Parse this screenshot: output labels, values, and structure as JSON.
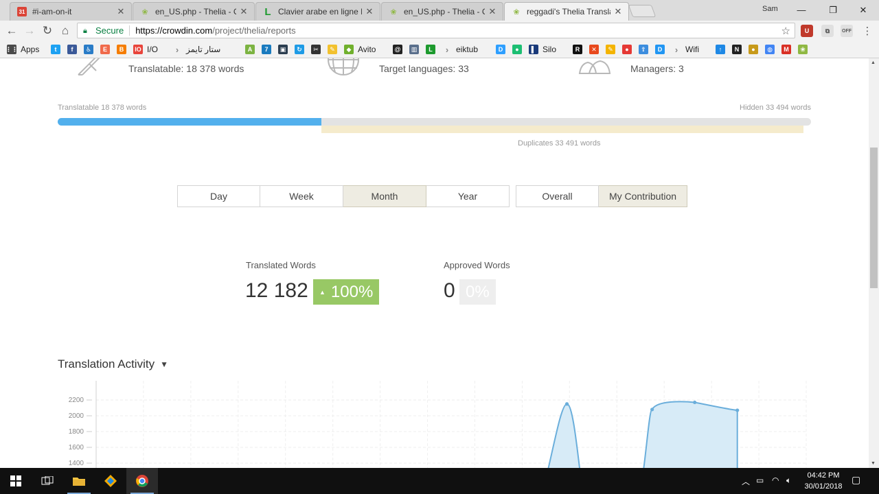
{
  "browser": {
    "tabs": [
      {
        "title": "#i-am-on-it",
        "icon": "google-calendar-icon",
        "color": "#db4437"
      },
      {
        "title": "en_US.php - Thelia - Cro",
        "icon": "crowdin-icon",
        "color": "#8fb843"
      },
      {
        "title": "Clavier arabe en ligne LE",
        "icon": "lexilogos-icon",
        "color": "#1d9a2e"
      },
      {
        "title": "en_US.php - Thelia - Cro",
        "icon": "crowdin-icon",
        "color": "#8fb843"
      },
      {
        "title": "reggadi's Thelia Translati",
        "icon": "crowdin-icon",
        "color": "#8fb843"
      }
    ],
    "profile": "Sam",
    "address": {
      "secure_label": "Secure",
      "url_host": "https://crowdin.com",
      "url_path": "/project/thelia/reports"
    },
    "bookmarks": [
      {
        "label": "Apps",
        "icon": "apps-grid-icon",
        "color": "#4a4a4a"
      },
      {
        "label": "",
        "icon": "twitter-icon",
        "color": "#1da1f2"
      },
      {
        "label": "",
        "icon": "facebook-icon",
        "color": "#3b5998"
      },
      {
        "label": "",
        "icon": "accessibility-icon",
        "color": "#2a7cc7"
      },
      {
        "label": "",
        "icon": "bookmark-icon-e",
        "color": "#f06a4b"
      },
      {
        "label": "",
        "icon": "blogger-icon",
        "color": "#f57d00"
      },
      {
        "label": "I/O",
        "icon": "io-icon",
        "color": "#e8453c"
      },
      {
        "label": "ستار تايمز",
        "icon": "folder-chevron-icon",
        "color": "#888888"
      },
      {
        "label": "",
        "icon": "android-icon",
        "color": "#7cb342"
      },
      {
        "label": "",
        "icon": "app-icon-7",
        "color": "#1a7bbf"
      },
      {
        "label": "",
        "icon": "screen-icon",
        "color": "#2c3e50"
      },
      {
        "label": "",
        "icon": "refresh-circle-icon",
        "color": "#1e9be6"
      },
      {
        "label": "",
        "icon": "tool-icon",
        "color": "#333333"
      },
      {
        "label": "",
        "icon": "notes-icon",
        "color": "#f2c12e"
      },
      {
        "label": "Avito",
        "icon": "cube-icon",
        "color": "#70b02d"
      },
      {
        "label": "",
        "icon": "at-icon",
        "color": "#222222"
      },
      {
        "label": "",
        "icon": "library-icon",
        "color": "#5a6f8c"
      },
      {
        "label": "",
        "icon": "lexilogos-icon",
        "color": "#1d9a2e"
      },
      {
        "label": "eiktub",
        "icon": "folder-chevron-icon",
        "color": "#888888"
      },
      {
        "label": "",
        "icon": "disqus-icon",
        "color": "#2e9fff"
      },
      {
        "label": "",
        "icon": "circle-app-icon",
        "color": "#1dbf73"
      },
      {
        "label": "Silo",
        "icon": "silo-icon",
        "color": "#1a3a7a"
      },
      {
        "label": "",
        "icon": "r-icon",
        "color": "#111111"
      },
      {
        "label": "",
        "icon": "x-icon",
        "color": "#e8491d"
      },
      {
        "label": "",
        "icon": "pencil-icon",
        "color": "#f4b400"
      },
      {
        "label": "",
        "icon": "pin-icon",
        "color": "#e53935"
      },
      {
        "label": "",
        "icon": "share-icon",
        "color": "#3c8dde"
      },
      {
        "label": "",
        "icon": "d-icon",
        "color": "#2196f3"
      },
      {
        "label": "Wifi",
        "icon": "folder-chevron-icon",
        "color": "#888888"
      },
      {
        "label": "",
        "icon": "arrow-up-icon",
        "color": "#1e88e5"
      },
      {
        "label": "",
        "icon": "n-icon",
        "color": "#222222"
      },
      {
        "label": "",
        "icon": "coin-icon",
        "color": "#c79a1a"
      },
      {
        "label": "",
        "icon": "globe-icon",
        "color": "#4285f4"
      },
      {
        "label": "",
        "icon": "gmail-icon",
        "color": "#d93025"
      },
      {
        "label": "",
        "icon": "crowdin-icon",
        "color": "#8fb843"
      }
    ]
  },
  "summary": {
    "translatable_text": "Translatable: 18 378 words",
    "target_languages_text": "Target languages: 33",
    "managers_text": "Managers: 3"
  },
  "words_bar": {
    "left_label": "Translatable 18 378 words",
    "right_label": "Hidden 33 494 words",
    "duplicates_label": "Duplicates 33 491 words",
    "translatable_fraction": 0.35,
    "duplicates_start_fraction": 0.35,
    "duplicates_end_fraction": 0.99
  },
  "period_buttons": [
    {
      "label": "Day",
      "selected": false
    },
    {
      "label": "Week",
      "selected": false
    },
    {
      "label": "Month",
      "selected": true
    },
    {
      "label": "Year",
      "selected": false
    }
  ],
  "scope_buttons": [
    {
      "label": "Overall",
      "selected": false
    },
    {
      "label": "My Contribution",
      "selected": true
    }
  ],
  "kpis": {
    "translated_label": "Translated Words",
    "translated_value": "12 182",
    "translated_pct": "100%",
    "approved_label": "Approved Words",
    "approved_value": "0",
    "approved_pct": "0%"
  },
  "activity": {
    "title": "Translation Activity"
  },
  "chart_data": {
    "type": "area",
    "title": "",
    "y_ticks": [
      "2200",
      "2000",
      "1800",
      "1600",
      "1400"
    ],
    "ylim": [
      1400,
      2200
    ],
    "x_count": 15,
    "series": [
      {
        "values": [
          null,
          null,
          null,
          null,
          null,
          null,
          null,
          null,
          null,
          null,
          null,
          null,
          2150,
          null,
          2080,
          2170,
          2070
        ]
      }
    ],
    "color": "#6aaedb",
    "fill": "#d7ebf7"
  },
  "taskbar": {
    "time": "04:42 PM",
    "date": "30/01/2018"
  }
}
